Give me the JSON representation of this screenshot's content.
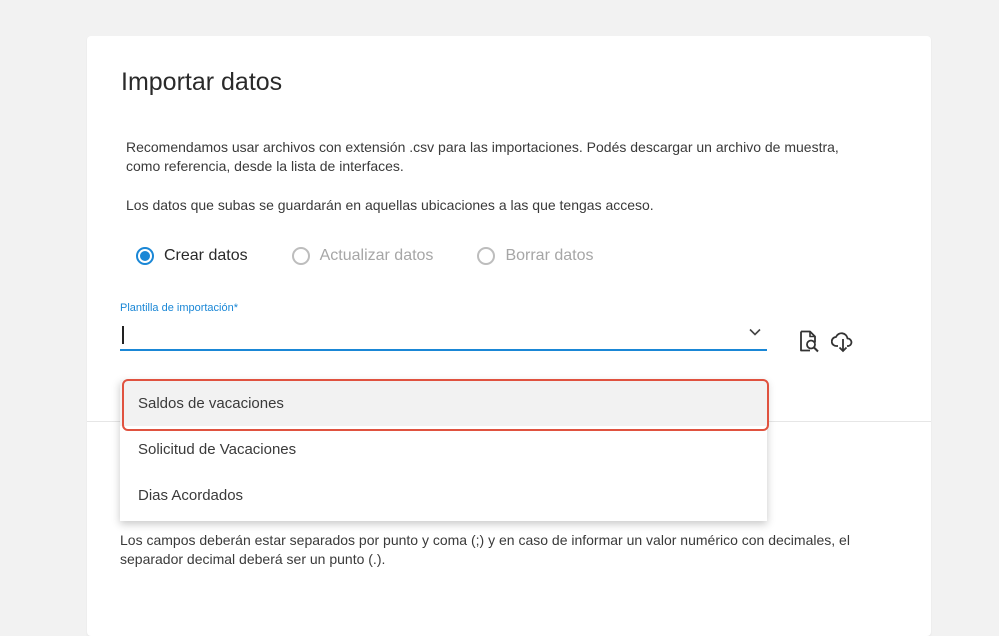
{
  "page": {
    "title": "Importar datos",
    "paragraph1": "Recomendamos usar archivos con extensión .csv para las importaciones. Podés descargar un archivo de muestra, como referencia, desde la lista de interfaces.",
    "paragraph2": "Los datos que subas se guardarán en aquellas ubicaciones a las que tengas acceso.",
    "paragraph3": "Los campos deberán estar separados por punto y coma (;) y en caso de informar un valor numérico con decimales, el separador decimal deberá ser un punto (.)."
  },
  "mode_options": [
    {
      "label": "Crear datos",
      "checked": true
    },
    {
      "label": "Actualizar datos",
      "checked": false
    },
    {
      "label": "Borrar datos",
      "checked": false
    }
  ],
  "template_field": {
    "label": "Plantilla de importación*",
    "value": ""
  },
  "dropdown": {
    "options": [
      "Saldos de vacaciones",
      "Solicitud de Vacaciones",
      "Dias Acordados"
    ],
    "highlighted_index": 0
  },
  "icons": {
    "preview": "file-search-icon",
    "download": "cloud-download-icon",
    "chevron": "chevron-down-icon"
  },
  "colors": {
    "accent": "#1a87d6",
    "highlight_border": "#e0523f",
    "disabled_text": "#a6a6a6"
  }
}
